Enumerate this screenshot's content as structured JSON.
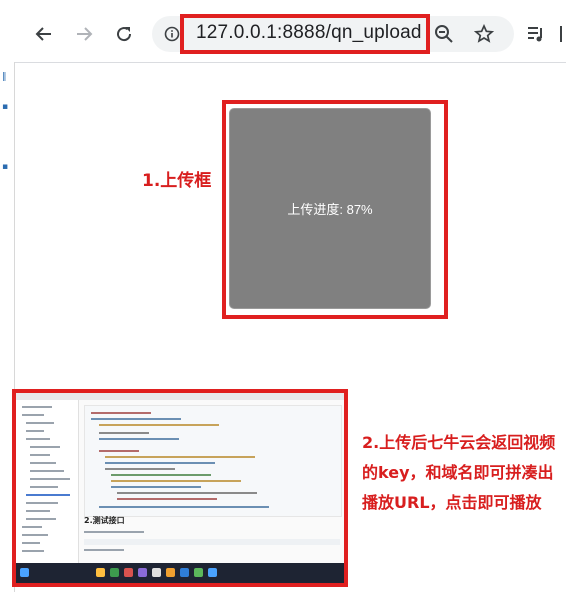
{
  "browser": {
    "url": "127.0.0.1:8888/qn_upload",
    "icons": {
      "back": "arrow-left-icon",
      "forward": "arrow-right-icon",
      "reload": "reload-icon",
      "info": "info-icon",
      "zoom": "zoom-out-icon",
      "bookmark": "star-icon",
      "media": "media-queue-icon"
    }
  },
  "upload": {
    "label": "1.上传框",
    "progress_text": "上传进度: 87%"
  },
  "annotation": {
    "label": "2.上传后七牛云会返回视频的key，和域名即可拼凑出播放URL，点击即可播放"
  },
  "thumbnail": {
    "heading": "2.测试接口"
  },
  "colors": {
    "highlight_red": "#e02020",
    "label_red": "#d81e1e",
    "upload_gray": "#808080"
  }
}
